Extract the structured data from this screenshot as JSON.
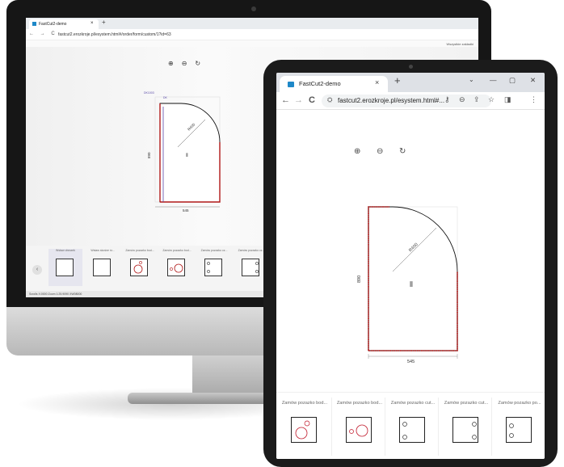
{
  "imac": {
    "tab_title": "FastCut2-demo",
    "url": "fastcut2.erozkroje.pl/esystem.html#/order/form/custom/1?id=63",
    "bookmark": "Wszystkie zakładki",
    "dim_width": "545",
    "dim_height": "890",
    "dim_radius": "R400",
    "corner_label_1": "DK1003",
    "corner_label_2": "DK",
    "thumbs": [
      {
        "label": "Wstaw obrazek"
      },
      {
        "label": "Wstaw skośne śr..."
      },
      {
        "label": "Zamów pozazko bod..."
      },
      {
        "label": "Zamów pozazko bod..."
      },
      {
        "label": "Zamów pozazko cz..."
      },
      {
        "label": "Zamów pozazko cz..."
      }
    ],
    "status": "Scrolls X:0000   Zoom 1:25.9090   XW08000"
  },
  "tablet": {
    "tab_title": "FastCut2-demo",
    "tab_close": "×",
    "new_tab": "+",
    "chevron": "⌄",
    "win_minimize": "—",
    "win_restore": "▢",
    "win_close": "✕",
    "back": "←",
    "forward": "→",
    "reload": "C",
    "lock": "⛭",
    "url": "fastcut2.erozkroje.pl/esystem.html#...",
    "key_icon": "⚷",
    "zoom_icon": "⊖",
    "share_icon": "⇪",
    "star_icon": "☆",
    "sidebar_icon": "◨",
    "menu_icon": "⋮",
    "zoom_in": "⊕",
    "zoom_out": "⊖",
    "reset": "↻",
    "dim_width": "545",
    "dim_height": "890",
    "dim_radius": "R400",
    "thumbs": [
      {
        "label": "Zamów pozazko bod..."
      },
      {
        "label": "Zamów pozazko bod..."
      },
      {
        "label": "Zamów pozazko cut..."
      },
      {
        "label": "Zamów pozazko cut..."
      },
      {
        "label": "Zamów pozazko po..."
      }
    ]
  },
  "colors": {
    "edge_red": "#b01818",
    "edge_purple": "#5a4aa8",
    "favicon": "#1e88c8"
  }
}
